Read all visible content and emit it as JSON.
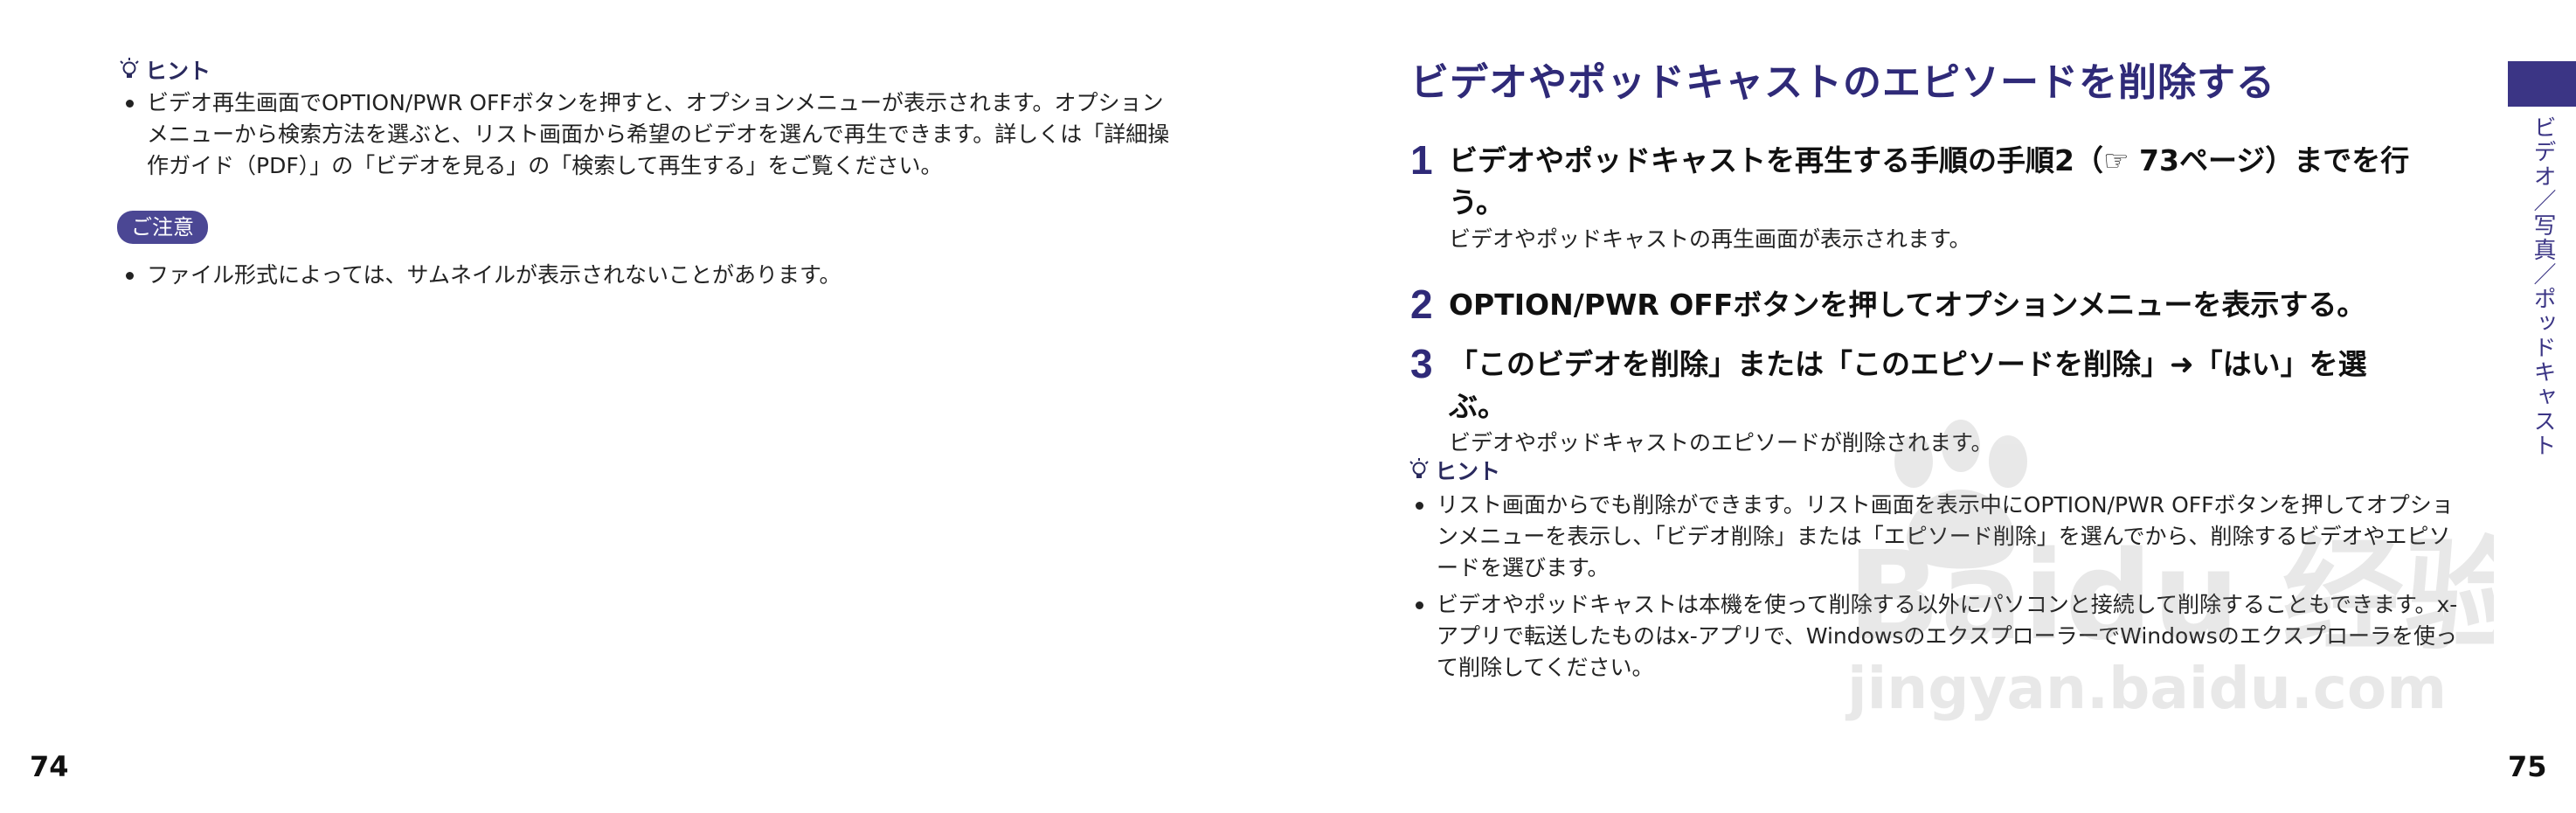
{
  "left_page": {
    "hint_label": "ヒント",
    "hint_bullets": [
      "ビデオ再生画面でOPTION/PWR OFFボタンを押すと、オプションメニューが表示されます。オプションメニューから検索方法を選ぶと、リスト画面から希望のビデオを選んで再生できます。詳しくは「詳細操作ガイド（PDF）」の「ビデオを見る」の「検索して再生する」をご覧ください。"
    ],
    "caution_label": "ご注意",
    "caution_bullets": [
      "ファイル形式によっては、サムネイルが表示されないことがあります。"
    ],
    "page_number": "74"
  },
  "right_page": {
    "title": "ビデオやポッドキャストのエピソードを削除する",
    "steps": [
      {
        "num": "1",
        "text": "ビデオやポッドキャストを再生する手順の手順2（☞ 73ページ）までを行う。",
        "sub": "ビデオやポッドキャストの再生画面が表示されます。"
      },
      {
        "num": "2",
        "text": "OPTION/PWR OFFボタンを押してオプションメニューを表示する。",
        "sub": ""
      },
      {
        "num": "3",
        "text": "「このビデオを削除」または「このエピソードを削除」➜「はい」を選ぶ。",
        "sub": "ビデオやポッドキャストのエピソードが削除されます。"
      }
    ],
    "hint_label": "ヒント",
    "hint_bullets": [
      "リスト画面からでも削除ができます。リスト画面を表示中にOPTION/PWR OFFボタンを押してオプションメニューを表示し、「ビデオ削除」または「エピソード削除」を選んでから、削除するビデオやエピソードを選びます。",
      "ビデオやポッドキャストは本機を使って削除する以外にパソコンと接続して削除することもできます。x-アプリで転送したものはx-アプリで、WindowsのエクスプローラーでWindowsのエクスプローラを使って削除してください。"
    ],
    "side_label": "ビデオ／写真／ポッドキャスト",
    "page_number": "75"
  },
  "watermark": {
    "logo_text": "Baidu 经验",
    "url_text": "jingyan.baidu.com"
  },
  "colors": {
    "accent": "#2f2a78",
    "badge": "#4b4794",
    "tab": "#3b3585"
  }
}
